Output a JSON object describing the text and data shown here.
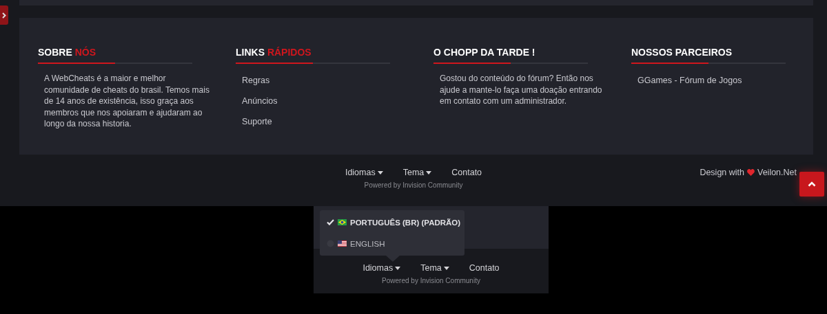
{
  "columns": [
    {
      "kind": "text",
      "title": "SOBRE",
      "title_accent": "NÓS",
      "text": "A WebCheats é a maior e melhor comunidade de cheats do brasil. Temos mais de 14 anos de existência, isso graça aos membros que nos apoiaram e ajudaram ao longo da nossa historia."
    },
    {
      "kind": "links",
      "title": "LINKS",
      "title_accent": "RÁPIDOS",
      "links": [
        "Regras",
        "Anúncios",
        "Suporte"
      ]
    },
    {
      "kind": "text",
      "title": "O CHOPP DA TARDE !",
      "text": "Gostou do conteúdo do fórum? Então nos ajude a mante-lo faça uma doação entrando em contato com um administrador."
    },
    {
      "kind": "links",
      "title": "NOSSOS PARCEIROS",
      "links": [
        "GGames - Fórum de Jogos"
      ]
    }
  ],
  "footer_bar": {
    "menu": [
      {
        "label": "Idiomas",
        "dropdown": true
      },
      {
        "label": "Tema",
        "dropdown": true
      },
      {
        "label": "Contato",
        "dropdown": false
      }
    ],
    "powered": "Powered by Invision Community",
    "credit_prefix": "Design with",
    "credit_brand": "Veilon.Net"
  },
  "inset": {
    "language_menu": [
      {
        "label": "PORTUGUÊS (BR) (PADRÃO)",
        "selected": true,
        "kind": "br"
      },
      {
        "label": "ENGLISH",
        "selected": false,
        "kind": "us"
      }
    ],
    "menu": [
      {
        "label": "Idiomas",
        "dropdown": true
      },
      {
        "label": "Tema",
        "dropdown": true
      },
      {
        "label": "Contato",
        "dropdown": false
      }
    ],
    "powered": "Powered by Invision Community"
  }
}
